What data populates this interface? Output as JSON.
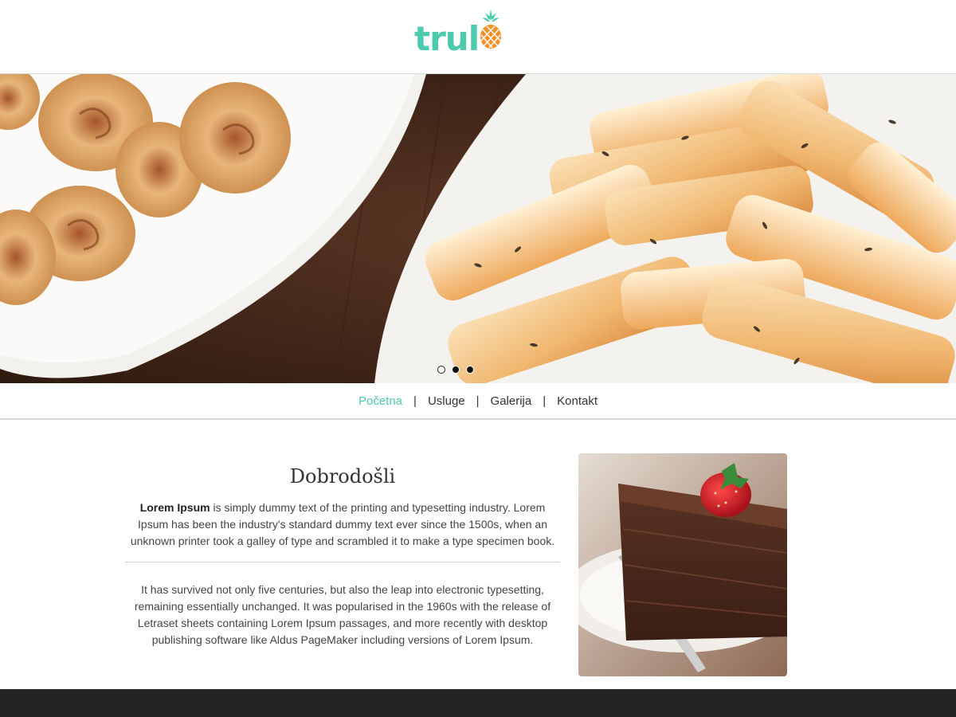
{
  "brand": {
    "logo_text": "trul",
    "logo_icon": "pineapple-icon",
    "accent_color": "#4ccaae"
  },
  "hero": {
    "slides_total": 3,
    "active_slide": 1
  },
  "nav": {
    "items": [
      {
        "label": "Početna",
        "active": true
      },
      {
        "label": "Usluge",
        "active": false
      },
      {
        "label": "Galerija",
        "active": false
      },
      {
        "label": "Kontakt",
        "active": false
      }
    ],
    "separator": "|"
  },
  "main": {
    "title": "Dobrodošli",
    "intro_bold": "Lorem Ipsum",
    "intro_rest": " is simply dummy text of the printing and typesetting industry. Lorem Ipsum has been the industry's standard dummy text ever since the 1500s, when an unknown printer took a galley of type and scrambled it to make a type specimen book.",
    "second_paragraph": "It has survived not only five centuries, but also the leap into electronic typesetting, remaining essentially unchanged. It was popularised in the 1960s with the release of Letraset sheets containing Lorem Ipsum passages, and more recently with desktop publishing software like Aldus PageMaker including versions of Lorem Ipsum."
  },
  "footer": {
    "background": "#232323"
  }
}
